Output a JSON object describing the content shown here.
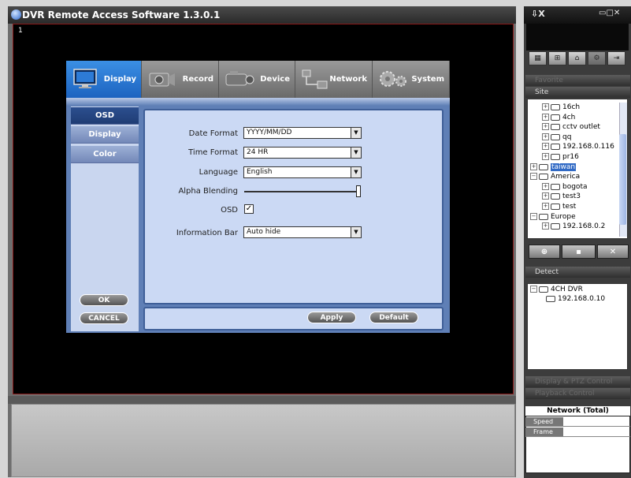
{
  "window": {
    "title": "DVR Remote Access Software  1.3.0.1",
    "video_channel": "1"
  },
  "setup": {
    "tabs": [
      {
        "label": "Display",
        "icon": "monitor-icon",
        "active": true
      },
      {
        "label": "Record",
        "icon": "record-icon",
        "active": false
      },
      {
        "label": "Device",
        "icon": "camera-icon",
        "active": false
      },
      {
        "label": "Network",
        "icon": "network-icon",
        "active": false
      },
      {
        "label": "System",
        "icon": "gears-icon",
        "active": false
      }
    ],
    "side_menu": [
      "OSD",
      "Display",
      "Color"
    ],
    "osd": {
      "date_format_label": "Date Format",
      "date_format_value": "YYYY/MM/DD",
      "time_format_label": "Time Format",
      "time_format_value": "24 HR",
      "language_label": "Language",
      "language_value": "English",
      "alpha_blending_label": "Alpha Blending",
      "alpha_blending_level": 1.0,
      "osd_label": "OSD",
      "osd_checked": true,
      "info_bar_label": "Information Bar",
      "info_bar_value": "Auto hide"
    },
    "buttons": {
      "ok": "OK",
      "cancel": "CANCEL",
      "apply": "Apply",
      "default": "Default"
    }
  },
  "right_panel": {
    "favorite_label": "Favorite",
    "site_label": "Site",
    "site_tree": [
      {
        "label": "16ch",
        "level": 2
      },
      {
        "label": "4ch",
        "level": 2
      },
      {
        "label": "cctv outlet",
        "level": 2
      },
      {
        "label": "qq",
        "level": 2
      },
      {
        "label": "192.168.0.116",
        "level": 2
      },
      {
        "label": "pr16",
        "level": 2
      },
      {
        "label": "taiwan",
        "level": 1,
        "selected": true
      },
      {
        "label": "America",
        "level": 1
      },
      {
        "label": "bogota",
        "level": 2
      },
      {
        "label": "test3",
        "level": 2
      },
      {
        "label": "test",
        "level": 2
      },
      {
        "label": "Europe",
        "level": 1
      },
      {
        "label": "192.168.0.2",
        "level": 2
      }
    ],
    "detect_label": "Detect",
    "detect_tree": [
      {
        "label": "4CH DVR",
        "level": 1
      },
      {
        "label": "192.168.0.10",
        "level": 2
      }
    ],
    "display_ptz_label": "Display & PTZ Control",
    "playback_label": "Playback Control",
    "network": {
      "title": "Network (Total)",
      "rows": [
        "Speed",
        "Frame"
      ]
    }
  },
  "colors": {
    "accent": "#1c63c0",
    "dialog": "#5f7fb6",
    "content_bg": "#cbd9f4",
    "selected": "#316ac5"
  }
}
